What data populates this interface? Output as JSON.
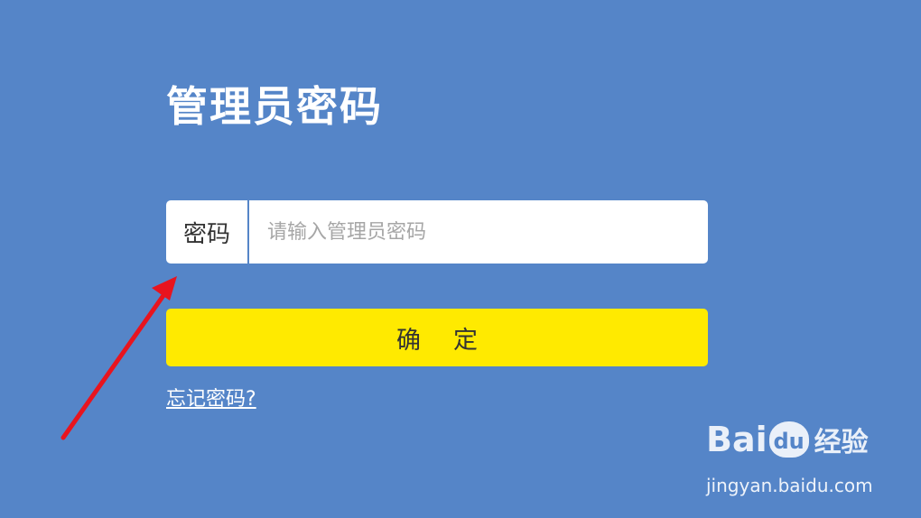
{
  "page": {
    "title": "管理员密码"
  },
  "password_field": {
    "label": "密码",
    "value": "",
    "placeholder": "请输入管理员密码"
  },
  "confirm_button": {
    "label": "确定"
  },
  "forgot_link": {
    "label": "忘记密码?"
  },
  "watermark": {
    "brand_a": "Bai",
    "brand_b": "du",
    "brand_c": "经验",
    "url": "jingyan.baidu.com"
  },
  "colors": {
    "background": "#5585c8",
    "button": "#ffea00",
    "annotation_arrow": "#e8141e"
  }
}
